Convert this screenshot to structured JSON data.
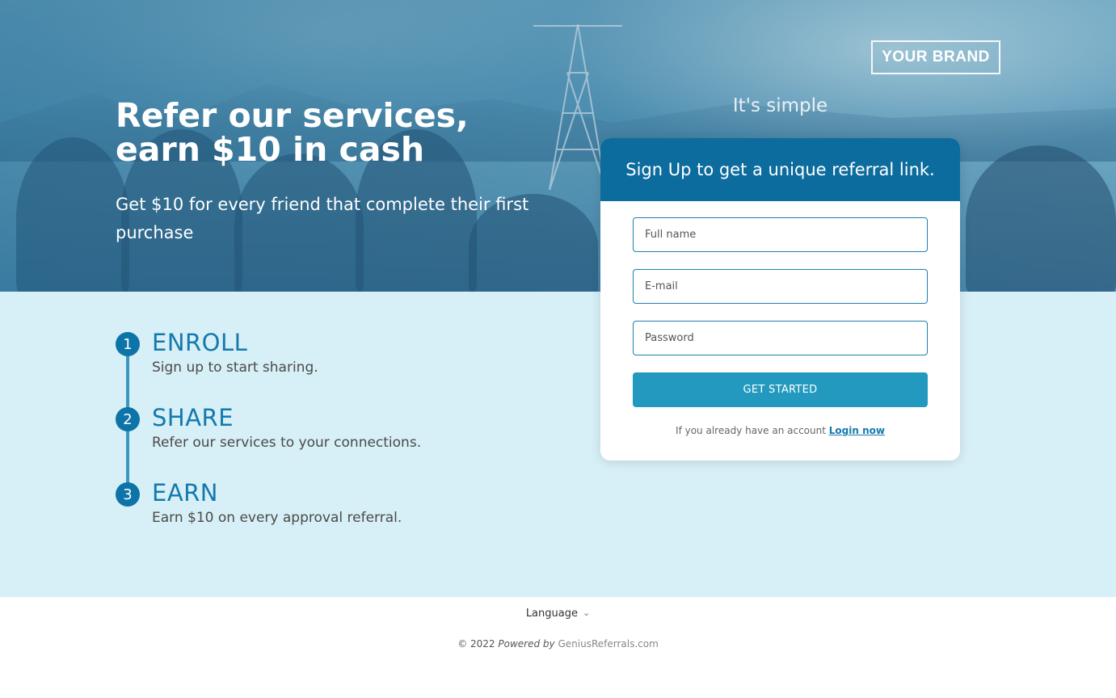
{
  "brand": {
    "logo_text": "YOUR BRAND"
  },
  "hero": {
    "title": "Refer our services, earn $10 in cash",
    "subtitle": "Get $10 for every friend that complete their first purchase",
    "tagline": "It's simple"
  },
  "steps": [
    {
      "number": "1",
      "title": "ENROLL",
      "description": "Sign up to start sharing."
    },
    {
      "number": "2",
      "title": "SHARE",
      "description": "Refer our services to your connections."
    },
    {
      "number": "3",
      "title": "EARN",
      "description": "Earn $10 on every approval referral."
    }
  ],
  "signup": {
    "heading": "Sign Up to get a unique referral link.",
    "fullname_placeholder": "Full name",
    "email_placeholder": "E-mail",
    "password_placeholder": "Password",
    "submit_label": "GET STARTED",
    "login_prompt": "If you already have an account",
    "login_link": "Login now"
  },
  "footer": {
    "language_label": "Language",
    "copyright": "© 2022",
    "powered_by": "Powered by",
    "powered_link": "GeniusReferrals.com"
  },
  "colors": {
    "primary": "#0d6c9e",
    "accent": "#2399bf",
    "steps_background": "#d7eff6",
    "step_title": "#1479ad"
  }
}
